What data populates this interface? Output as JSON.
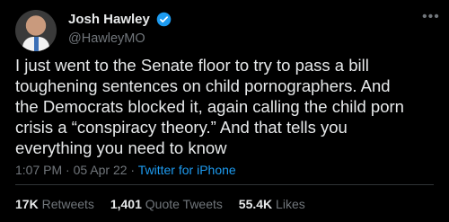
{
  "author": {
    "name": "Josh Hawley",
    "handle": "@HawleyMO",
    "verified_color": "#1d9bf0"
  },
  "tweet": {
    "text": "I just went to the Senate floor to try to pass a bill\ntoughening sentences on child pornographers. And\nthe Democrats blocked it, again calling the child porn\ncrisis a “conspiracy theory.” And that tells you\neverything you need to know",
    "time": "1:07 PM",
    "separator": "·",
    "date": "05 Apr 22",
    "source": "Twitter for iPhone"
  },
  "stats": {
    "retweets_count": "17K",
    "retweets_label": "Retweets",
    "quotes_count": "1,401",
    "quotes_label": "Quote Tweets",
    "likes_count": "55.4K",
    "likes_label": "Likes"
  },
  "icons": {
    "more": "more-options-icon",
    "verified": "verified-badge-icon"
  },
  "colors": {
    "background": "#000000",
    "text": "#e7e9ea",
    "secondary": "#71767b",
    "link": "#1d9bf0"
  }
}
